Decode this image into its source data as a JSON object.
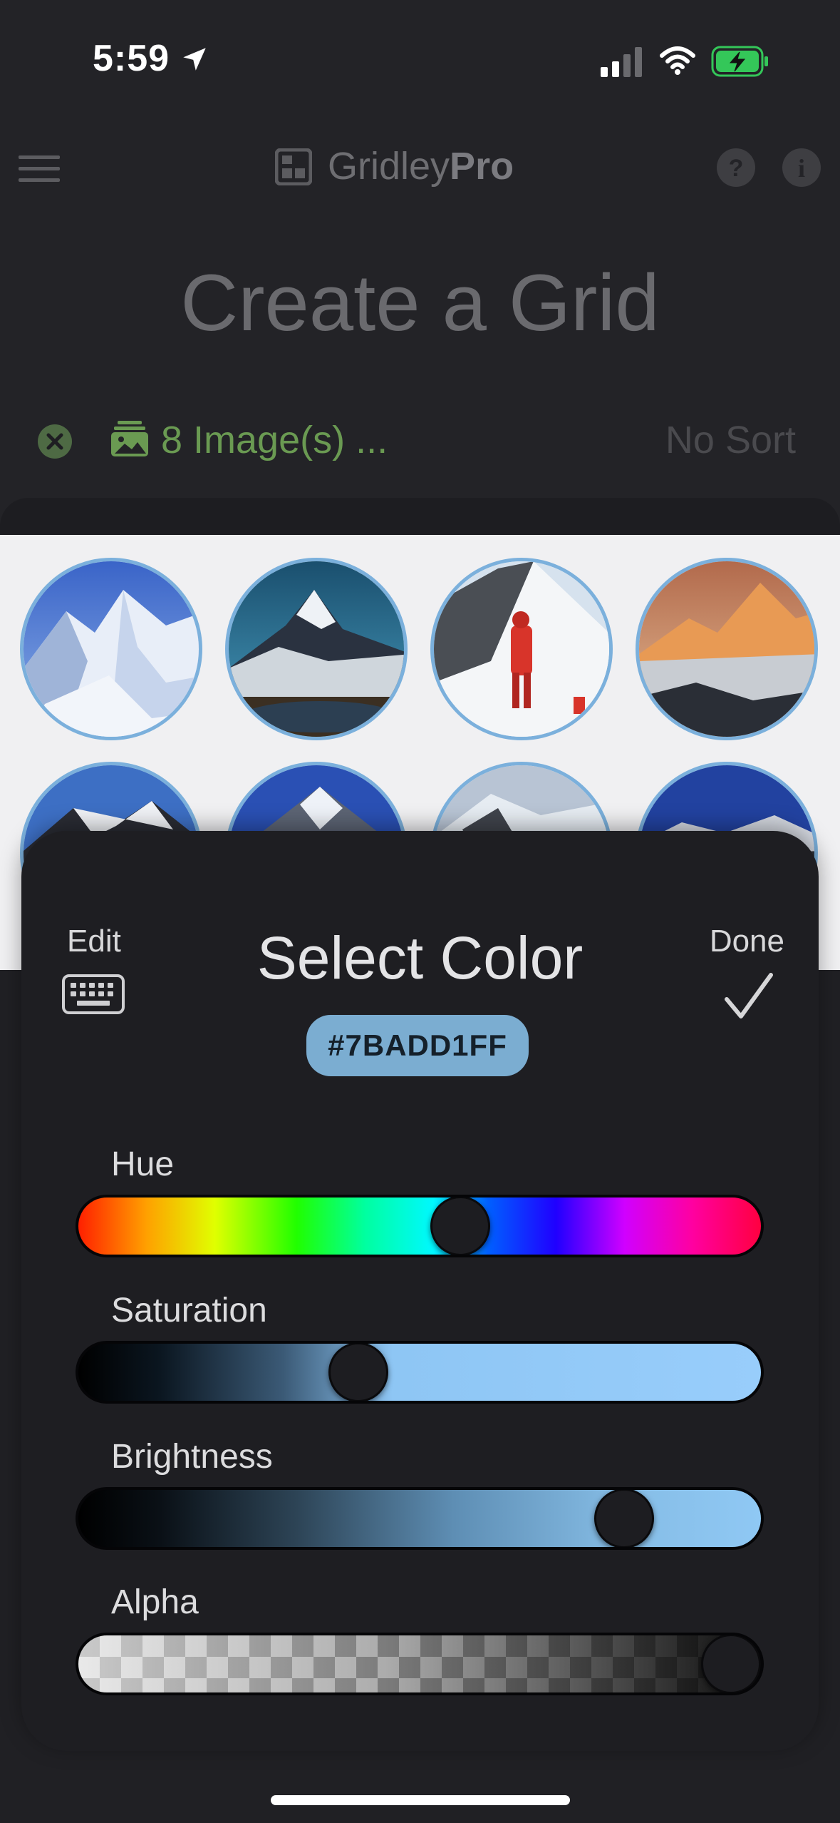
{
  "status_bar": {
    "time": "5:59",
    "icons": [
      "location-arrow-icon",
      "cellular-signal-icon",
      "wifi-icon",
      "battery-charging-icon"
    ],
    "battery_color": "#34c759"
  },
  "app": {
    "name_regular": "Gridley",
    "name_bold": "Pro",
    "page_title": "Create a Grid",
    "images_label": "8 Image(s) ...",
    "sort_label": "No Sort",
    "accent_green": "#6a9a52",
    "thumbnails": [
      {
        "icon": "everest-snow-photo"
      },
      {
        "icon": "everest-lake-photo"
      },
      {
        "icon": "climber-summit-photo"
      },
      {
        "icon": "sunset-peaks-photo"
      },
      {
        "icon": "mountain-photo-5"
      },
      {
        "icon": "mountain-photo-6"
      },
      {
        "icon": "mountain-photo-7"
      },
      {
        "icon": "mountain-photo-8"
      }
    ]
  },
  "picker": {
    "edit_label": "Edit",
    "title": "Select Color",
    "done_label": "Done",
    "hex_value": "#7BADD1FF",
    "selected_color": "#7BADD1",
    "sliders": {
      "hue": {
        "label": "Hue",
        "value": 0.56
      },
      "saturation": {
        "label": "Saturation",
        "value": 0.41
      },
      "brightness": {
        "label": "Brightness",
        "value": 0.8
      },
      "alpha": {
        "label": "Alpha",
        "value": 1.0
      }
    }
  }
}
